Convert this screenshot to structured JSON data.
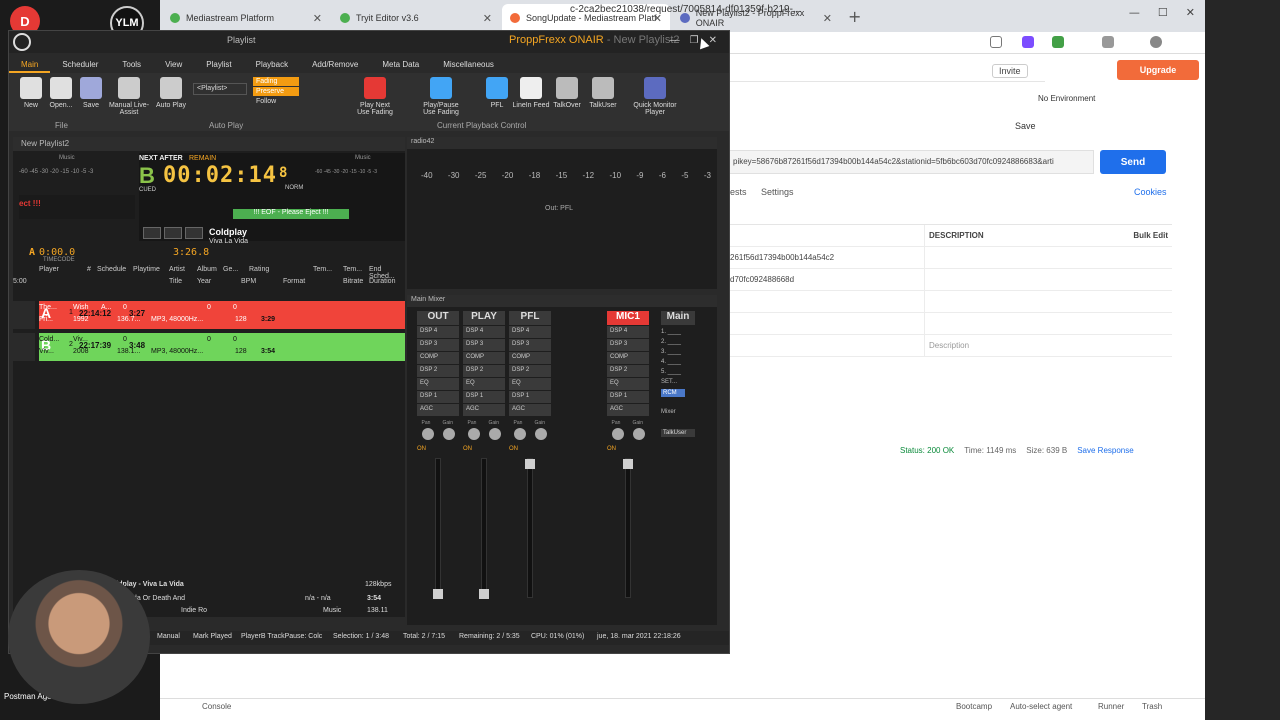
{
  "browser": {
    "tabs": [
      {
        "label": "Mediastream Platform",
        "color": "#4caf50"
      },
      {
        "label": "Tryit Editor v3.6",
        "color": "#4caf50"
      },
      {
        "label": "SongUpdate - Mediastream Platf",
        "color": "#f26b3a"
      },
      {
        "label": "New Playlist2 - ProppFrexx ONAIR",
        "color": "#5c6bc0"
      }
    ],
    "url": "c-2ca2bec21038/request/7005814-df01359f-b219-..."
  },
  "postman": {
    "invite": "Invite",
    "upgrade": "Upgrade",
    "environment": "No Environment",
    "save": "Save",
    "request_url": "pikey=58676b87261f56d17394b00b144a54c2&stationid=5fb6bc603d70fc0924886683&arti",
    "send": "Send",
    "tab_tests": "ests",
    "tab_settings": "Settings",
    "cookies": "Cookies",
    "col_description": "DESCRIPTION",
    "bulk_edit": "Bulk Edit",
    "rows": [
      {
        "value": "261f56d17394b00b144a54c2",
        "desc": ""
      },
      {
        "value": "d70fc092488668d",
        "desc": ""
      },
      {
        "value": "",
        "desc": ""
      },
      {
        "value": "",
        "desc": ""
      },
      {
        "value": "",
        "desc": "Description"
      }
    ],
    "status": "Status: 200 OK",
    "time": "Time: 1149 ms",
    "size": "Size: 639 B",
    "save_response": "Save Response",
    "footer": {
      "console": "Console",
      "bootcamp": "Bootcamp",
      "auto_select": "Auto-select agent",
      "runner": "Runner",
      "trash": "Trash"
    }
  },
  "desktop": {
    "ym_label": "YLM",
    "agent_label": "Postman Agent",
    "red_icon": "D"
  },
  "proppfrexx": {
    "playlist_label": "Playlist",
    "app_title": "ProppFrexx ONAIR",
    "app_subtitle": "- New Playlist2",
    "menu": [
      "Main",
      "Scheduler",
      "Tools",
      "View",
      "Playlist",
      "Playback",
      "Add/Remove",
      "Meta Data",
      "Miscellaneous"
    ],
    "ribbon": [
      {
        "label": "New",
        "color": "#e0e0e0"
      },
      {
        "label": "Open...",
        "color": "#e0e0e0"
      },
      {
        "label": "Save",
        "color": "#9fa8da"
      },
      {
        "label": "Manual Live-Assist",
        "color": "#cccccc"
      },
      {
        "label": "Auto Play",
        "color": "#cccccc"
      },
      {
        "label": "Play Next Use Fading",
        "color": "#e53935"
      },
      {
        "label": "Play/Pause Use Fading",
        "color": "#42a5f5"
      },
      {
        "label": "PFL",
        "color": "#42a5f5"
      },
      {
        "label": "LineIn Feed",
        "color": "#eeeeee"
      },
      {
        "label": "TalkOver",
        "color": "#bbbbbb"
      },
      {
        "label": "TalkUser",
        "color": "#bbbbbb"
      },
      {
        "label": "Quick Monitor Player",
        "color": "#5c6bc0"
      }
    ],
    "playlist_select": "<Playlist>",
    "fading": [
      "Fading",
      "Preserve",
      "Follow"
    ],
    "groups": {
      "file": "File",
      "autoplay": "Auto Play",
      "playback": "Current Playback Control"
    },
    "panel_title": "New Playlist2",
    "vu_label": "Music",
    "vu_scale": "-60 -45 -30 -20 -15 -10 -5 -3",
    "wave_left_text": "ect !!!",
    "next_after": "NEXT AFTER",
    "remain": "REMAIN",
    "deck_letter": "B",
    "cued": "CUED",
    "remain_time": "00:02:14",
    "remain_frac": "8",
    "norm": "NORM",
    "eof": "!!! EOF - Please Eject !!!",
    "np_artist": "Coldplay",
    "np_title": "Viva La Vida",
    "timecode_letter": "A",
    "timecode": "0:00.0",
    "timecode_label": "TIMECODE",
    "duration": "3:26.8",
    "headers1": [
      "Player",
      "#",
      "Schedule",
      "Playtime",
      "Artist",
      "Album",
      "Ge...",
      "Rating",
      "Tem...",
      "Tem...",
      "End Sched..."
    ],
    "headers2": [
      "Title",
      "Year",
      "BPM",
      "Format",
      "Bitrate",
      "Duration"
    ],
    "time_prefix": "5:00",
    "rows": [
      {
        "letter": "A",
        "idx": "1",
        "schedule": "22:14:12",
        "playtime": "3:27",
        "artist": "The...",
        "album": "Wish",
        "genre": "A...",
        "r1": "0",
        "r2": "0",
        "r3": "0",
        "title": "Fri...",
        "year": "1992",
        "bpm": "136.7...",
        "format": "MP3, 48000Hz...",
        "bitrate": "128",
        "duration": "3:29"
      },
      {
        "letter": "B",
        "idx": "2",
        "schedule": "22:17:39",
        "playtime": "3:48",
        "artist": "Cold...",
        "album": "Viv...",
        "genre": "",
        "r1": "0",
        "r2": "0",
        "r3": "0",
        "title": "Viv...",
        "year": "2008",
        "bpm": "138.1...",
        "format": "MP3, 48000Hz...",
        "bitrate": "128",
        "duration": "3:54"
      }
    ],
    "now_playing": {
      "line": "Coldplay - Viva La Vida",
      "album": "a Vida Or Death And",
      "genre": "Indie Ro",
      "bitrate": "128kbps",
      "na": "n/a - n/a",
      "dur": "3:54",
      "music": "Music",
      "bpm": "138.11"
    },
    "radio42": {
      "title": "radio42",
      "scale": [
        "-40",
        "-30",
        "-25",
        "-20",
        "-18",
        "-15",
        "-12",
        "-10",
        "-9",
        "-6",
        "-5",
        "-3"
      ],
      "out": "Out: PFL"
    },
    "mixer": {
      "title": "Main Mixer",
      "strips": [
        {
          "name": "OUT",
          "dsps": [
            "DSP 4",
            "DSP 3",
            "COMP",
            "DSP 2",
            "EQ",
            "DSP 1",
            "AGC"
          ]
        },
        {
          "name": "PLAY",
          "dsps": [
            "DSP 4",
            "DSP 3",
            "COMP",
            "DSP 2",
            "EQ",
            "DSP 1",
            "AGC"
          ]
        },
        {
          "name": "PFL",
          "dsps": [
            "DSP 4",
            "DSP 3",
            "COMP",
            "DSP 2",
            "EQ",
            "DSP 1",
            "AGC"
          ]
        },
        {
          "name": "MIC1",
          "dsps": [
            "DSP 4",
            "DSP 3",
            "COMP",
            "DSP 2",
            "EQ",
            "DSP 1",
            "AGC"
          ]
        }
      ],
      "pan": "Pan",
      "gain": "Gain",
      "on": "ON",
      "main": "Main",
      "set": "SET...",
      "rcm": "RCM",
      "mixer_lbl": "Mixer",
      "talkuser": "TalkUser"
    },
    "status": {
      "manual": "Manual",
      "mark": "Mark Played",
      "playerb": "PlayerB TrackPause: Colc",
      "selection": "Selection: 1 / 3:48",
      "total": "Total: 2 / 7:15",
      "remaining": "Remaining: 2 / 5:35",
      "cpu": "CPU: 01% (01%)",
      "date": "jue, 18. mar 2021 22:18:26"
    }
  }
}
